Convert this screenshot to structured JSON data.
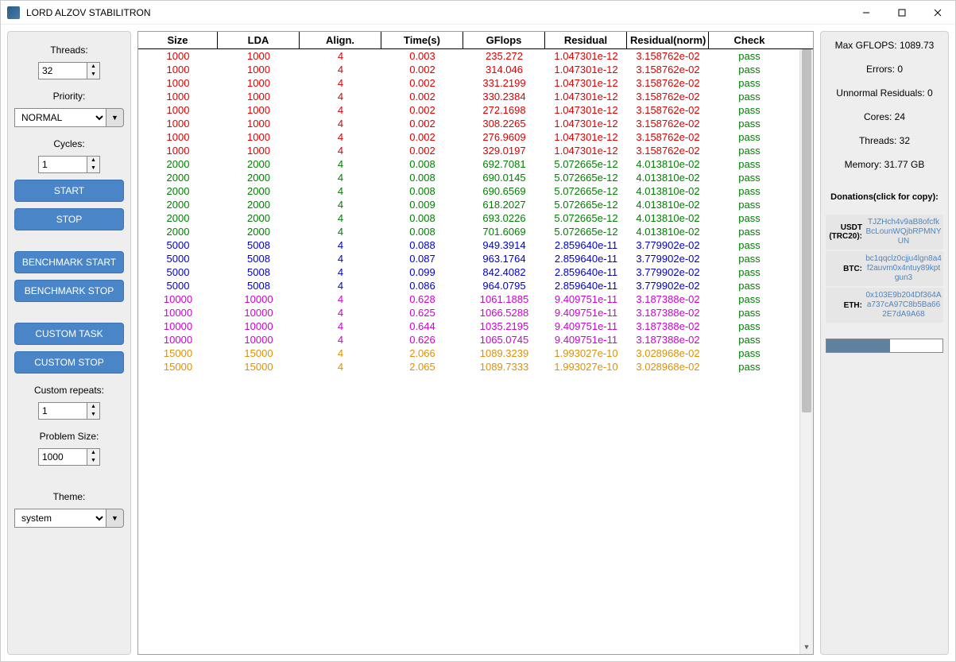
{
  "title": "LORD ALZOV STABILITRON",
  "left": {
    "threads_label": "Threads:",
    "threads_value": "32",
    "priority_label": "Priority:",
    "priority_value": "NORMAL",
    "cycles_label": "Cycles:",
    "cycles_value": "1",
    "start": "START",
    "stop": "STOP",
    "bench_start": "BENCHMARK START",
    "bench_stop": "BENCHMARK STOP",
    "custom_task": "CUSTOM TASK",
    "custom_stop": "CUSTOM STOP",
    "custom_repeats_label": "Custom repeats:",
    "custom_repeats_value": "1",
    "problem_size_label": "Problem Size:",
    "problem_size_value": "1000",
    "theme_label": "Theme:",
    "theme_value": "system"
  },
  "headers": [
    "Size",
    "LDA",
    "Align.",
    "Time(s)",
    "GFlops",
    "Residual",
    "Residual(norm)",
    "Check"
  ],
  "rows": [
    {
      "c": "red",
      "size": "1000",
      "lda": "1000",
      "align": "4",
      "time": "0.003",
      "gflops": "235.272",
      "resid": "1.047301e-12",
      "residn": "3.158762e-02",
      "check": "pass"
    },
    {
      "c": "red",
      "size": "1000",
      "lda": "1000",
      "align": "4",
      "time": "0.002",
      "gflops": "314.046",
      "resid": "1.047301e-12",
      "residn": "3.158762e-02",
      "check": "pass"
    },
    {
      "c": "red",
      "size": "1000",
      "lda": "1000",
      "align": "4",
      "time": "0.002",
      "gflops": "331.2199",
      "resid": "1.047301e-12",
      "residn": "3.158762e-02",
      "check": "pass"
    },
    {
      "c": "red",
      "size": "1000",
      "lda": "1000",
      "align": "4",
      "time": "0.002",
      "gflops": "330.2384",
      "resid": "1.047301e-12",
      "residn": "3.158762e-02",
      "check": "pass"
    },
    {
      "c": "red",
      "size": "1000",
      "lda": "1000",
      "align": "4",
      "time": "0.002",
      "gflops": "272.1698",
      "resid": "1.047301e-12",
      "residn": "3.158762e-02",
      "check": "pass"
    },
    {
      "c": "red",
      "size": "1000",
      "lda": "1000",
      "align": "4",
      "time": "0.002",
      "gflops": "308.2265",
      "resid": "1.047301e-12",
      "residn": "3.158762e-02",
      "check": "pass"
    },
    {
      "c": "red",
      "size": "1000",
      "lda": "1000",
      "align": "4",
      "time": "0.002",
      "gflops": "276.9609",
      "resid": "1.047301e-12",
      "residn": "3.158762e-02",
      "check": "pass"
    },
    {
      "c": "red",
      "size": "1000",
      "lda": "1000",
      "align": "4",
      "time": "0.002",
      "gflops": "329.0197",
      "resid": "1.047301e-12",
      "residn": "3.158762e-02",
      "check": "pass"
    },
    {
      "c": "green",
      "size": "2000",
      "lda": "2000",
      "align": "4",
      "time": "0.008",
      "gflops": "692.7081",
      "resid": "5.072665e-12",
      "residn": "4.013810e-02",
      "check": "pass"
    },
    {
      "c": "green",
      "size": "2000",
      "lda": "2000",
      "align": "4",
      "time": "0.008",
      "gflops": "690.0145",
      "resid": "5.072665e-12",
      "residn": "4.013810e-02",
      "check": "pass"
    },
    {
      "c": "green",
      "size": "2000",
      "lda": "2000",
      "align": "4",
      "time": "0.008",
      "gflops": "690.6569",
      "resid": "5.072665e-12",
      "residn": "4.013810e-02",
      "check": "pass"
    },
    {
      "c": "green",
      "size": "2000",
      "lda": "2000",
      "align": "4",
      "time": "0.009",
      "gflops": "618.2027",
      "resid": "5.072665e-12",
      "residn": "4.013810e-02",
      "check": "pass"
    },
    {
      "c": "green",
      "size": "2000",
      "lda": "2000",
      "align": "4",
      "time": "0.008",
      "gflops": "693.0226",
      "resid": "5.072665e-12",
      "residn": "4.013810e-02",
      "check": "pass"
    },
    {
      "c": "green",
      "size": "2000",
      "lda": "2000",
      "align": "4",
      "time": "0.008",
      "gflops": "701.6069",
      "resid": "5.072665e-12",
      "residn": "4.013810e-02",
      "check": "pass"
    },
    {
      "c": "blue",
      "size": "5000",
      "lda": "5008",
      "align": "4",
      "time": "0.088",
      "gflops": "949.3914",
      "resid": "2.859640e-11",
      "residn": "3.779902e-02",
      "check": "pass"
    },
    {
      "c": "blue",
      "size": "5000",
      "lda": "5008",
      "align": "4",
      "time": "0.087",
      "gflops": "963.1764",
      "resid": "2.859640e-11",
      "residn": "3.779902e-02",
      "check": "pass"
    },
    {
      "c": "blue",
      "size": "5000",
      "lda": "5008",
      "align": "4",
      "time": "0.099",
      "gflops": "842.4082",
      "resid": "2.859640e-11",
      "residn": "3.779902e-02",
      "check": "pass"
    },
    {
      "c": "blue",
      "size": "5000",
      "lda": "5008",
      "align": "4",
      "time": "0.086",
      "gflops": "964.0795",
      "resid": "2.859640e-11",
      "residn": "3.779902e-02",
      "check": "pass"
    },
    {
      "c": "magenta",
      "size": "10000",
      "lda": "10000",
      "align": "4",
      "time": "0.628",
      "gflops": "1061.1885",
      "resid": "9.409751e-11",
      "residn": "3.187388e-02",
      "check": "pass"
    },
    {
      "c": "magenta",
      "size": "10000",
      "lda": "10000",
      "align": "4",
      "time": "0.625",
      "gflops": "1066.5288",
      "resid": "9.409751e-11",
      "residn": "3.187388e-02",
      "check": "pass"
    },
    {
      "c": "magenta",
      "size": "10000",
      "lda": "10000",
      "align": "4",
      "time": "0.644",
      "gflops": "1035.2195",
      "resid": "9.409751e-11",
      "residn": "3.187388e-02",
      "check": "pass"
    },
    {
      "c": "magenta",
      "size": "10000",
      "lda": "10000",
      "align": "4",
      "time": "0.626",
      "gflops": "1065.0745",
      "resid": "9.409751e-11",
      "residn": "3.187388e-02",
      "check": "pass"
    },
    {
      "c": "orange",
      "size": "15000",
      "lda": "15000",
      "align": "4",
      "time": "2.066",
      "gflops": "1089.3239",
      "resid": "1.993027e-10",
      "residn": "3.028968e-02",
      "check": "pass"
    },
    {
      "c": "orange",
      "size": "15000",
      "lda": "15000",
      "align": "4",
      "time": "2.065",
      "gflops": "1089.7333",
      "resid": "1.993027e-10",
      "residn": "3.028968e-02",
      "check": "pass"
    }
  ],
  "right": {
    "max_gflops": "Max GFLOPS: 1089.73",
    "errors": "Errors: 0",
    "unnormal": "Unnormal Residuals: 0",
    "cores": "Cores: 24",
    "threads": "Threads: 32",
    "memory": "Memory: 31.77 GB",
    "donations_label": "Donations(click for copy):",
    "donations": [
      {
        "label": "USDT (TRC20):",
        "addr": "TJZHch4v9aB8ofcfkBcLounWQjbRPMNYUN"
      },
      {
        "label": "BTC:",
        "addr": "bc1qqclz0cjju4lgn8a4f2auvm0x4ntuy89kptgun3"
      },
      {
        "label": "ETH:",
        "addr": "0x103E9b204Df364Aa737cA97C8b5Ba662E7dA9A68"
      }
    ]
  }
}
